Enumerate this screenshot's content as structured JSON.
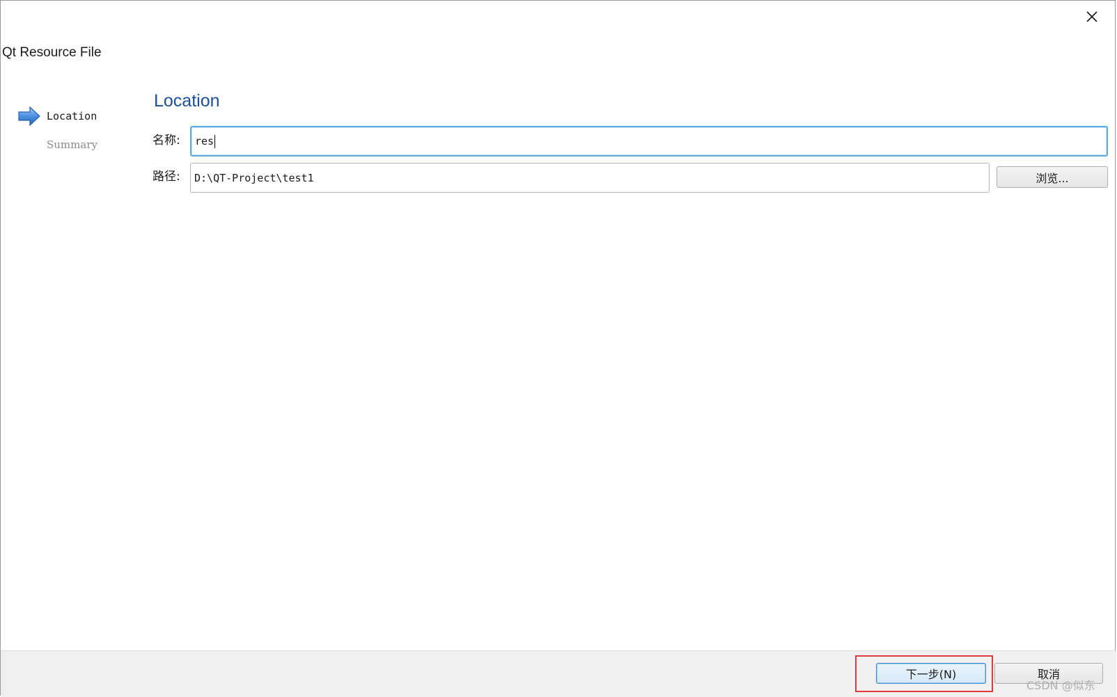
{
  "window": {
    "title": "Qt Resource File",
    "close_icon": "close-icon"
  },
  "steps": {
    "current_icon": "arrow-right-icon",
    "items": [
      {
        "label": "Location",
        "state": "current"
      },
      {
        "label": "Summary",
        "state": "pending"
      }
    ]
  },
  "page": {
    "heading": "Location",
    "name_label": "名称:",
    "name_value": "res",
    "path_label": "路径:",
    "path_value": "D:\\QT-Project\\test1",
    "browse_label": "浏览..."
  },
  "footer": {
    "next_label": "下一步(N)",
    "cancel_label": "取消"
  },
  "watermark": "CSDN @似东",
  "colors": {
    "heading": "#1b4fa0",
    "focus_border": "#5aa9e6",
    "highlight_box": "#e23a3a"
  }
}
